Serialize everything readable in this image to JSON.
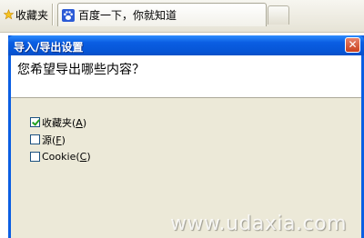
{
  "toolbar": {
    "favorites_label": "收藏夹",
    "favorites_icon": "star-icon",
    "tab_title": "百度一下，你就知道",
    "tab_icon": "baidu-paw-icon"
  },
  "dialog": {
    "title": "导入/导出设置",
    "close_glyph": "✕",
    "question": "您希望导出哪些内容？",
    "options": [
      {
        "label": "收藏夹",
        "mnemonic": "A",
        "checked": true
      },
      {
        "label": "源",
        "mnemonic": "F",
        "checked": false
      },
      {
        "label": "Cookie",
        "mnemonic": "C",
        "checked": false
      }
    ]
  },
  "watermark": "www.udaxia.com",
  "colors": {
    "titlebar": "#0a5ee3",
    "close_button": "#d9532e",
    "dialog_body": "#ece9d8",
    "check_mark": "#21a121"
  }
}
